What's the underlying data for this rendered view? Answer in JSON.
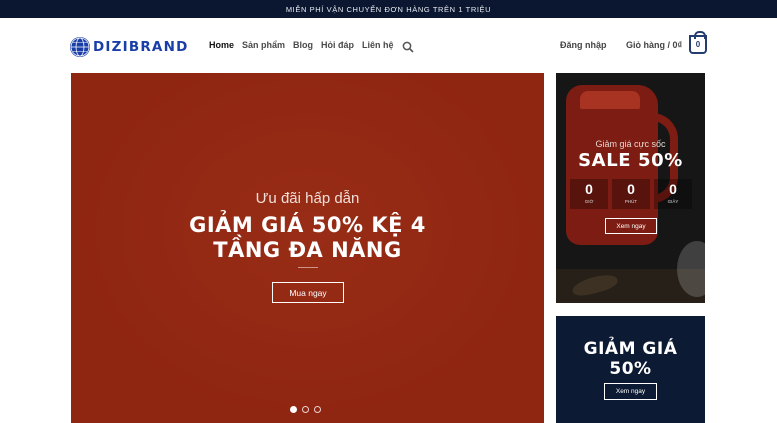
{
  "topbar": {
    "announcement": "MIỄN PHÍ VẬN CHUYỂN ĐƠN HÀNG TRÊN 1 TRIỆU"
  },
  "header": {
    "logo_text": "DIZIBRAND",
    "nav": [
      {
        "label": "Home",
        "active": true
      },
      {
        "label": "Sản phẩm"
      },
      {
        "label": "Blog"
      },
      {
        "label": "Hỏi đáp"
      },
      {
        "label": "Liên hệ"
      }
    ],
    "search_icon": "search-icon",
    "login_label": "Đăng nhập",
    "cart_label": "Giỏ hàng / 0₫",
    "cart_count": "0"
  },
  "hero": {
    "subtitle": "Ưu đãi hấp dẫn",
    "title_line1": "GIẢM GIÁ 50% KỆ 4",
    "title_line2": "TẦNG ĐA NĂNG",
    "button": "Mua ngay",
    "slides": 3,
    "active_slide": 1,
    "background": "#8f2612"
  },
  "promo_sale": {
    "subtitle": "Giảm giá cực sốc",
    "title": "SALE 50%",
    "countdown": [
      {
        "value": "0",
        "unit": "GIỜ"
      },
      {
        "value": "0",
        "unit": "PHÚT"
      },
      {
        "value": "0",
        "unit": "GIÂY"
      }
    ],
    "button": "Xem ngay"
  },
  "promo_discount": {
    "title_line1": "GIẢM GIÁ",
    "title_line2": "50%",
    "button": "Xem ngay",
    "background": "#0d1a33"
  }
}
